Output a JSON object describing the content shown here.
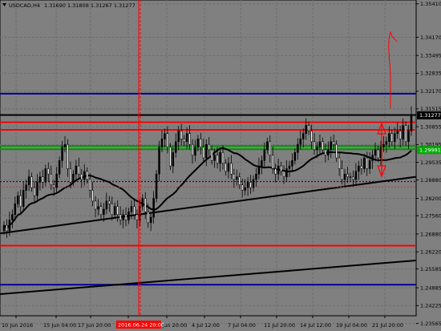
{
  "header": {
    "symbol": "USDCAD,H4",
    "ohlc": "1.31690 1.31808 1.31267 1.31277"
  },
  "colors": {
    "background": "#808080",
    "candle": "#000000",
    "grid": "#6e6e6e",
    "blue_line": "#000099",
    "red_line": "#ff0000",
    "green_line": "#009900",
    "black_line": "#000000",
    "dotted_line": "#000066",
    "vertical_marker": "#ff0000",
    "price_tag_bg": "#000000",
    "green_tag_bg": "#00aa00",
    "time_tag_bg": "#ff0000"
  },
  "chart_data": {
    "type": "candlestick",
    "ylim": [
      1.2385,
      1.3555
    ],
    "y_ticks": [
      "1.35410",
      "1.34170",
      "1.33495",
      "1.32835",
      "1.32170",
      "1.31515",
      "1.30855",
      "1.30195",
      "1.29535",
      "1.28880",
      "1.28200",
      "1.27560",
      "1.26880",
      "1.26220",
      "1.25585",
      "1.24885",
      "1.24225",
      "1.23565"
    ],
    "x_ticks": [
      "10 Jun 2016",
      "15 Jun 04:00",
      "17 Jun 20:00",
      "22 Jun 12:00",
      "29 Jun 20:00",
      "4 Jul 12:00",
      "7 Jul 04:00",
      "11 Jul 20:00",
      "14 Jul 12:00",
      "19 Jul 04:00",
      "21 Jul 20:00"
    ],
    "time_marker_label": "2016.06.24 20:00",
    "current_price_label": "1.31277",
    "green_level_label": "1.29991",
    "close": [
      1.272,
      1.27,
      1.274,
      1.276,
      1.28,
      1.283,
      1.279,
      1.285,
      1.287,
      1.29,
      1.286,
      1.283,
      1.288,
      1.29,
      1.288,
      1.293,
      1.291,
      1.287,
      1.286,
      1.291,
      1.296,
      1.301,
      1.302,
      1.293,
      1.288,
      1.291,
      1.294,
      1.291,
      1.289,
      1.292,
      1.289,
      1.285,
      1.281,
      1.278,
      1.279,
      1.276,
      1.278,
      1.281,
      1.28,
      1.276,
      1.279,
      1.276,
      1.274,
      1.276,
      1.274,
      1.277,
      1.279,
      1.276,
      1.274,
      1.279,
      1.282,
      1.277,
      1.273,
      1.275,
      1.282,
      1.291,
      1.301,
      1.304,
      1.306,
      1.301,
      1.294,
      1.299,
      1.303,
      1.307,
      1.304,
      1.303,
      1.306,
      1.302,
      1.298,
      1.301,
      1.304,
      1.301,
      1.297,
      1.302,
      1.3,
      1.296,
      1.298,
      1.295,
      1.299,
      1.295,
      1.292,
      1.295,
      1.291,
      1.289,
      1.29,
      1.287,
      1.285,
      1.286,
      1.288,
      1.286,
      1.289,
      1.291,
      1.294,
      1.296,
      1.3,
      1.303,
      1.298,
      1.293,
      1.291,
      1.294,
      1.292,
      1.29,
      1.293,
      1.294,
      1.296,
      1.299,
      1.302,
      1.304,
      1.306,
      1.309,
      1.307,
      1.303,
      1.3,
      1.301,
      1.303,
      1.3,
      1.298,
      1.3,
      1.303,
      1.302,
      1.297,
      1.293,
      1.289,
      1.291,
      1.29,
      1.29,
      1.289,
      1.292,
      1.294,
      1.293,
      1.297,
      1.293,
      1.296,
      1.298,
      1.3,
      1.297,
      1.301,
      1.302,
      1.303,
      1.306,
      1.303,
      1.306,
      1.307,
      1.304,
      1.309,
      1.303,
      1.307,
      1.313
    ],
    "series_names": [],
    "overlays": [
      {
        "type": "horizontal",
        "color": "blue",
        "price": 1.3208
      },
      {
        "type": "horizontal",
        "color": "black",
        "price": 1.3129
      },
      {
        "type": "horizontal",
        "color": "red",
        "price": 1.3102
      },
      {
        "type": "horizontal",
        "color": "red",
        "price": 1.3074
      },
      {
        "type": "horizontal",
        "color": "green",
        "price": 1.3014
      },
      {
        "type": "horizontal",
        "color": "green",
        "price": 1.3002
      },
      {
        "type": "horizontal",
        "color": "red",
        "price": 1.2645
      },
      {
        "type": "horizontal",
        "color": "blue",
        "price": 1.25
      },
      {
        "type": "trend",
        "color": "black",
        "from_price": 1.269,
        "to_price": 1.29
      },
      {
        "type": "trend",
        "color": "black",
        "from_price": 1.2465,
        "to_price": 1.259
      },
      {
        "type": "moving_average",
        "color": "black"
      }
    ]
  }
}
